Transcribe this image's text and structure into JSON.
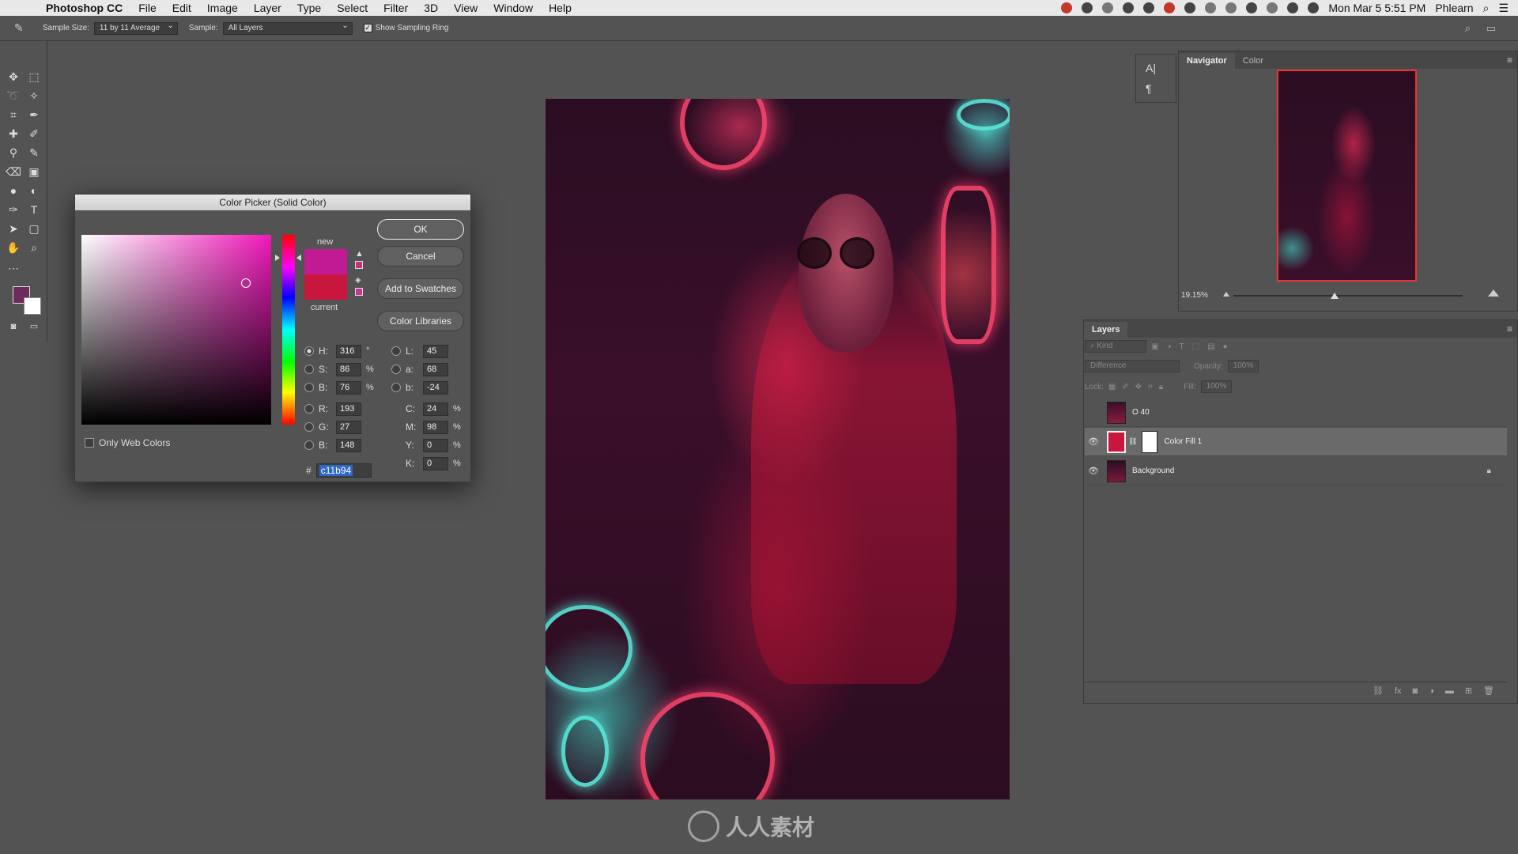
{
  "menubar": {
    "items": [
      "Photoshop CC",
      "File",
      "Edit",
      "Image",
      "Layer",
      "Type",
      "Select",
      "Filter",
      "3D",
      "View",
      "Window",
      "Help"
    ],
    "clock": "Mon Mar 5  5:51 PM",
    "user": "Phlearn"
  },
  "options": {
    "sample_size_label": "Sample Size:",
    "sample_size_value": "11 by 11 Average",
    "sample_label": "Sample:",
    "sample_value": "All Layers",
    "show_ring_label": "Show Sampling Ring",
    "show_ring_checked": true
  },
  "colors": {
    "foreground": "#6b2b5d",
    "background": "#ffffff",
    "new_color": "#c11b94",
    "current_color": "#c8163f"
  },
  "picker": {
    "title": "Color Picker (Solid Color)",
    "new_label": "new",
    "current_label": "current",
    "ok": "OK",
    "cancel": "Cancel",
    "add_swatches": "Add to Swatches",
    "color_libraries": "Color Libraries",
    "web_only": "Only Web Colors",
    "hsb": [
      {
        "label": "H:",
        "value": "316",
        "unit": "°",
        "selected": true
      },
      {
        "label": "S:",
        "value": "86",
        "unit": "%"
      },
      {
        "label": "B:",
        "value": "76",
        "unit": "%"
      }
    ],
    "rgb": [
      {
        "label": "R:",
        "value": "193"
      },
      {
        "label": "G:",
        "value": "27"
      },
      {
        "label": "B:",
        "value": "148"
      }
    ],
    "lab": [
      {
        "label": "L:",
        "value": "45"
      },
      {
        "label": "a:",
        "value": "68"
      },
      {
        "label": "b:",
        "value": "-24"
      }
    ],
    "cmyk": [
      {
        "label": "C:",
        "value": "24",
        "unit": "%"
      },
      {
        "label": "M:",
        "value": "98",
        "unit": "%"
      },
      {
        "label": "Y:",
        "value": "0",
        "unit": "%"
      },
      {
        "label": "K:",
        "value": "0",
        "unit": "%"
      }
    ],
    "hex_prefix": "#",
    "hex": "c11b94"
  },
  "navigator": {
    "tabs": [
      "Navigator",
      "Color"
    ],
    "zoom": "19.15%"
  },
  "layers": {
    "title": "Layers",
    "kind_placeholder": "Kind",
    "blend_mode": "Difference",
    "opacity_label": "Opacity:",
    "opacity_value": "100%",
    "lock_label": "Lock:",
    "fill_label": "Fill:",
    "fill_value": "100%",
    "items": [
      {
        "name": "O 40",
        "visible": false
      },
      {
        "name": "Color Fill 1",
        "visible": true,
        "selected": true
      },
      {
        "name": "Background",
        "visible": true,
        "locked": true
      }
    ]
  },
  "watermark": "人人素材"
}
